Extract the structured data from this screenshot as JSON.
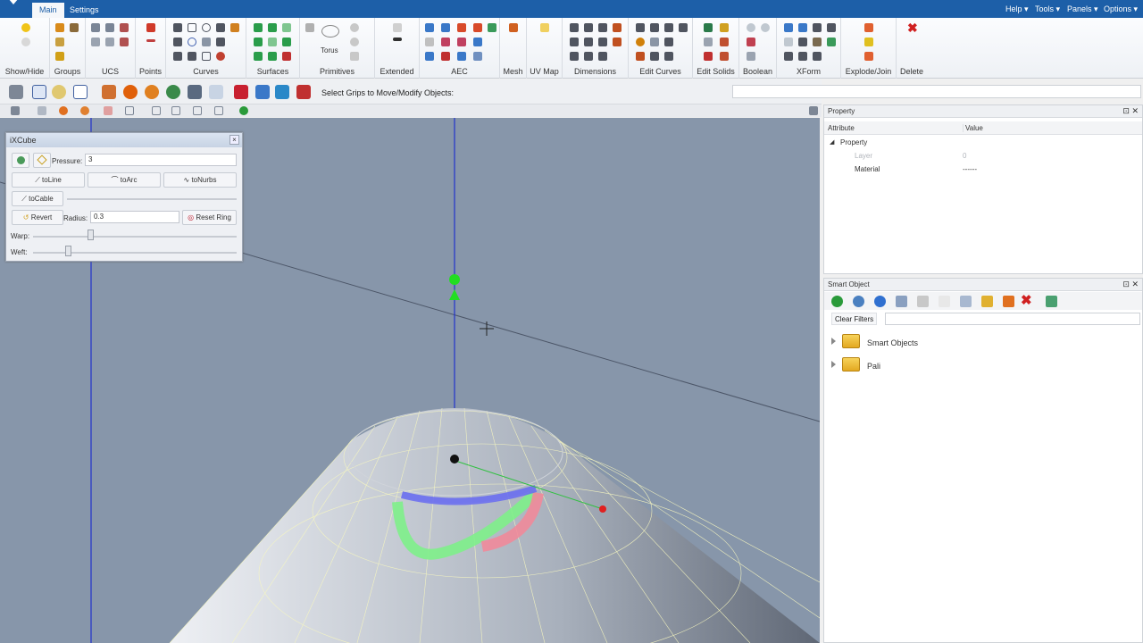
{
  "tabs": {
    "main": "Main",
    "settings": "Settings"
  },
  "menu": {
    "help": "Help",
    "tools": "Tools",
    "panels": "Panels",
    "options": "Options"
  },
  "ribbon_groups": [
    "Show/Hide",
    "Groups",
    "UCS",
    "Points",
    "Curves",
    "Surfaces",
    "Primitives",
    "Extended",
    "AEC",
    "Mesh",
    "UV Map",
    "Dimensions",
    "Edit Curves",
    "Edit Solids",
    "Boolean",
    "XForm",
    "Explode/Join",
    "Delete"
  ],
  "primitives_torus": "Torus",
  "hint": "Select Grips to Move/Modify Objects:",
  "ixcube": {
    "title": "iXCube",
    "pressure_label": "Pressure:",
    "pressure_value": "3",
    "toLine": "toLine",
    "toArc": "toArc",
    "toNurbs": "toNurbs",
    "toCable": "toCable",
    "revert": "Revert",
    "radius_label": "Radius:",
    "radius_value": "0.3",
    "reset_ring": "Reset Ring",
    "warp_label": "Warp:",
    "weft_label": "Weft:",
    "warp_level": 0.28,
    "weft_level": 0.17
  },
  "property_panel": {
    "title": "Property",
    "col_attr": "Attribute",
    "col_value": "Value",
    "group": "Property",
    "rows": [
      {
        "attr": "Layer",
        "value": "0"
      },
      {
        "attr": "Material",
        "value": "------"
      }
    ]
  },
  "smart_panel": {
    "title": "Smart Object",
    "clear_filters": "Clear Filters",
    "items": [
      "Smart Objects",
      "Pali"
    ]
  },
  "colors": {
    "accent": "#1d5fa8",
    "viewport": "#8796aa"
  }
}
